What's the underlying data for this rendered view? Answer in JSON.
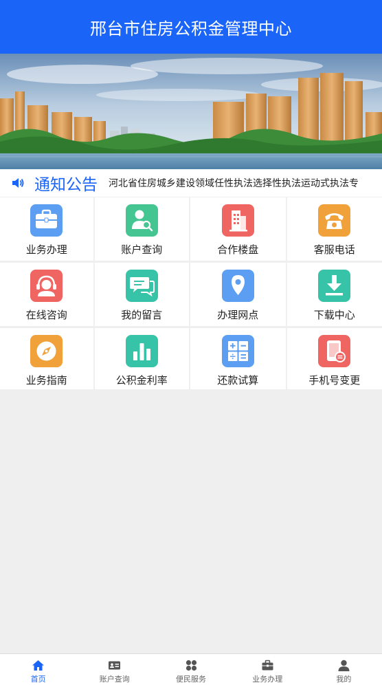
{
  "header": {
    "title": "邢台市住房公积金管理中心"
  },
  "notice": {
    "title": "通知公告",
    "ticker": "河北省住房城乡建设领域任性执法选择性执法运动式执法专"
  },
  "services": [
    {
      "label": "业务办理",
      "icon": "briefcase-icon",
      "color": "#5b9ef2"
    },
    {
      "label": "账户查询",
      "icon": "user-search-icon",
      "color": "#45c592"
    },
    {
      "label": "合作楼盘",
      "icon": "building-icon",
      "color": "#ef6562"
    },
    {
      "label": "客服电话",
      "icon": "phone-icon",
      "color": "#f0a13a"
    },
    {
      "label": "在线咨询",
      "icon": "headset-icon",
      "color": "#ef6562"
    },
    {
      "label": "我的留言",
      "icon": "chat-icon",
      "color": "#36c3a7"
    },
    {
      "label": "办理网点",
      "icon": "location-icon",
      "color": "#5b9ef2"
    },
    {
      "label": "下载中心",
      "icon": "download-icon",
      "color": "#36c3a7"
    },
    {
      "label": "业务指南",
      "icon": "compass-icon",
      "color": "#f0a13a"
    },
    {
      "label": "公积金利率",
      "icon": "bar-chart-icon",
      "color": "#36c3a7"
    },
    {
      "label": "还款试算",
      "icon": "calculator-icon",
      "color": "#5b9ef2"
    },
    {
      "label": "手机号变更",
      "icon": "mobile-icon",
      "color": "#ef6562"
    }
  ],
  "tabbar": {
    "items": [
      {
        "label": "首页",
        "icon": "home-icon",
        "active": true
      },
      {
        "label": "账户查询",
        "icon": "id-card-icon",
        "active": false
      },
      {
        "label": "便民服务",
        "icon": "apps-icon",
        "active": false
      },
      {
        "label": "业务办理",
        "icon": "briefcase-icon",
        "active": false
      },
      {
        "label": "我的",
        "icon": "person-icon",
        "active": false
      }
    ]
  },
  "colors": {
    "primary": "#1a64f8",
    "background": "#efefef"
  }
}
